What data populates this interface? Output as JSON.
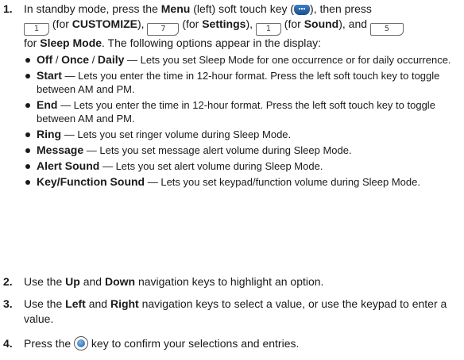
{
  "steps": [
    {
      "num": "1.",
      "parts": {
        "a": "In standby mode, press the ",
        "menu": "Menu",
        "b": " (left) soft touch key (",
        "c": "), then press",
        "key1": "1",
        "d": " (for ",
        "customize": "CUSTOMIZE",
        "e": "), ",
        "key7": "7",
        "f": " (for ",
        "settings": "Settings",
        "g": "), ",
        "key1b": "1",
        "h": " (for ",
        "sound": "Sound",
        "i": "), and ",
        "key5": "5",
        "j": " for ",
        "sleep_mode": "Sleep Mode",
        "k": ". The following options appear in the display:"
      },
      "options": [
        {
          "label": "Off",
          "sep": " / ",
          "label2": "Once",
          "sep2": " / ",
          "label3": "Daily",
          "text": " — Lets you set Sleep Mode for one occurrence or for daily occurrence."
        },
        {
          "label": "Start",
          "text": " — Lets you enter the time in 12-hour format. Press the left soft touch key to toggle between AM and PM."
        },
        {
          "label": "End",
          "text": " — Lets you enter the time in 12-hour format. Press the left soft touch key to toggle between AM and PM."
        },
        {
          "label": "Ring",
          "text": " — Lets you set ringer volume during Sleep Mode."
        },
        {
          "label": "Message",
          "text": " — Lets you set message alert volume during Sleep Mode."
        },
        {
          "label": "Alert Sound",
          "text": " — Lets you set alert volume during Sleep Mode."
        },
        {
          "label": "Key/Function Sound",
          "text": " — Lets you set keypad/function volume during Sleep Mode."
        }
      ]
    },
    {
      "num": "2.",
      "a": "Use the ",
      "b1": "Up",
      "c": " and ",
      "b2": "Down",
      "d": " navigation keys to highlight an option."
    },
    {
      "num": "3.",
      "a": "Use the ",
      "b1": "Left",
      "c": " and ",
      "b2": "Right",
      "d": " navigation keys to select a value, or use the keypad to enter a value."
    },
    {
      "num": "4.",
      "a": "Press the ",
      "b": " key to confirm your selections and entries."
    }
  ],
  "icons": {
    "menu_softkey": "menu-softkey-icon",
    "ok_key": "ok-key-icon"
  },
  "colors": {
    "softkey": "#2a64a8",
    "text": "#1a1a1a"
  }
}
